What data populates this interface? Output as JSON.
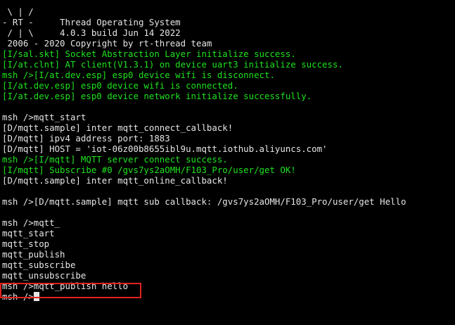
{
  "terminal": {
    "lines": [
      {
        "text": " \\ | /",
        "color": "white"
      },
      {
        "text": "- RT -     Thread Operating System",
        "color": "white"
      },
      {
        "text": " / | \\     4.0.3 build Jun 14 2022",
        "color": "white"
      },
      {
        "text": " 2006 - 2020 Copyright by rt-thread team",
        "color": "white"
      },
      {
        "text": "[I/sal.skt] Socket Abstraction Layer initialize success.",
        "color": "green"
      },
      {
        "text": "[I/at.clnt] AT client(V1.3.1) on device uart3 initialize success.",
        "color": "green"
      },
      {
        "text": "msh />[I/at.dev.esp] esp0 device wifi is disconnect.",
        "color": "green"
      },
      {
        "text": "[I/at.dev.esp] esp0 device wifi is connected.",
        "color": "green"
      },
      {
        "text": "[I/at.dev.esp] esp0 device network initialize successfully.",
        "color": "green"
      },
      {
        "text": "",
        "color": "white"
      },
      {
        "text": "msh />mqtt_start",
        "color": "white"
      },
      {
        "text": "[D/mqtt.sample] inter mqtt_connect_callback!",
        "color": "white"
      },
      {
        "text": "[D/mqtt] ipv4 address port: 1883",
        "color": "white"
      },
      {
        "text": "[D/mqtt] HOST = 'iot-06z00b8655ibl9u.mqtt.iothub.aliyuncs.com'",
        "color": "white"
      },
      {
        "text": "msh />[I/mqtt] MQTT server connect success.",
        "color": "green"
      },
      {
        "text": "[I/mqtt] Subscribe #0 /gvs7ys2aOMH/F103_Pro/user/get OK!",
        "color": "green"
      },
      {
        "text": "[D/mqtt.sample] inter mqtt_online_callback!",
        "color": "white"
      },
      {
        "text": "",
        "color": "white"
      },
      {
        "text": "msh />[D/mqtt.sample] mqtt sub callback: /gvs7ys2aOMH/F103_Pro/user/get Hello",
        "color": "white"
      },
      {
        "text": "",
        "color": "white"
      },
      {
        "text": "msh />mqtt_",
        "color": "white"
      },
      {
        "text": "mqtt_start",
        "color": "white"
      },
      {
        "text": "mqtt_stop",
        "color": "white"
      },
      {
        "text": "mqtt_publish",
        "color": "white"
      },
      {
        "text": "mqtt_subscribe",
        "color": "white"
      },
      {
        "text": "mqtt_unsubscribe",
        "color": "white"
      },
      {
        "text": "msh />mqtt_publish hello",
        "color": "white"
      }
    ],
    "prompt": "msh />",
    "colors": {
      "background": "#000000",
      "default_text": "#e6e6e6",
      "info_text": "#1ee31e",
      "highlight_border": "#e0221e"
    }
  }
}
